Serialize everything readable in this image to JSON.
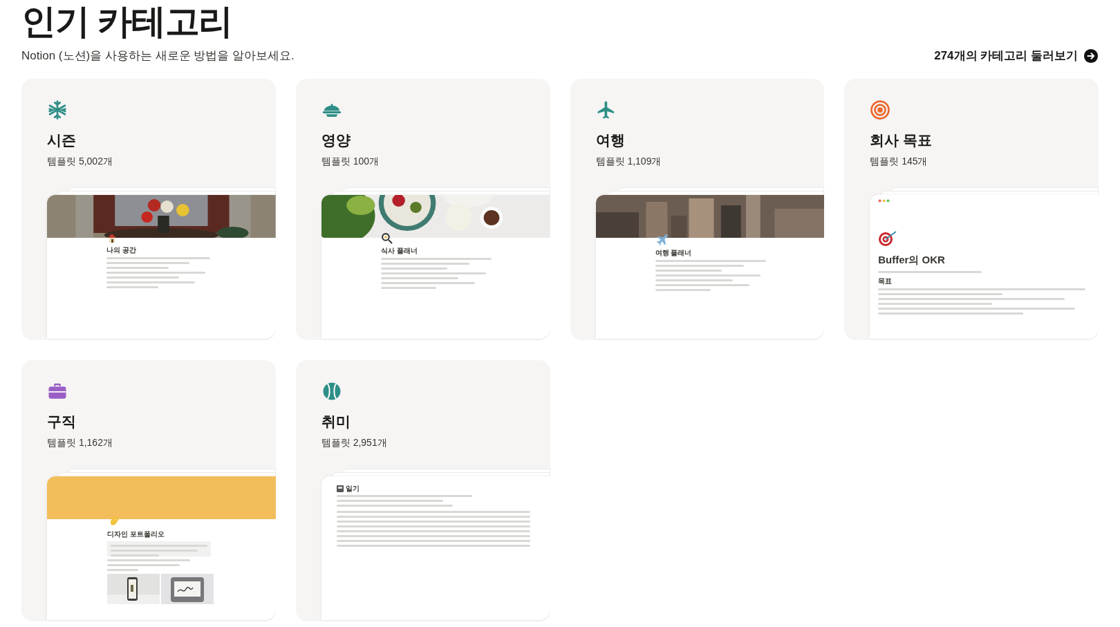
{
  "header": {
    "title": "인기 카테고리",
    "subtitle": "Notion (노션)을 사용하는 새로운 방법을 알아보세요.",
    "browse_link": "274개의 카테고리 둘러보기"
  },
  "categories": [
    {
      "name": "시즌",
      "count": "템플릿 5,002개",
      "color": "#2f8f88",
      "preview": {
        "kind": "cover",
        "title": "나의 공간"
      }
    },
    {
      "name": "영양",
      "count": "템플릿 100개",
      "color": "#2f8f88",
      "preview": {
        "kind": "cover",
        "title": "식사 플래너"
      }
    },
    {
      "name": "여행",
      "count": "템플릿 1,109개",
      "color": "#2f8f88",
      "preview": {
        "kind": "cover",
        "title": "여행 플래너"
      }
    },
    {
      "name": "회사 목표",
      "count": "템플릿 145개",
      "color": "#ea6a2e",
      "preview": {
        "kind": "window",
        "title": "Buffer의 OKR",
        "section": "목표"
      }
    },
    {
      "name": "구직",
      "count": "템플릿 1,162개",
      "color": "#9a5fc6",
      "preview": {
        "kind": "banner",
        "title": "디자인 포트폴리오"
      }
    },
    {
      "name": "취미",
      "count": "템플릿 2,951개",
      "color": "#2f8f88",
      "preview": {
        "kind": "plain",
        "title": "일기"
      }
    }
  ]
}
